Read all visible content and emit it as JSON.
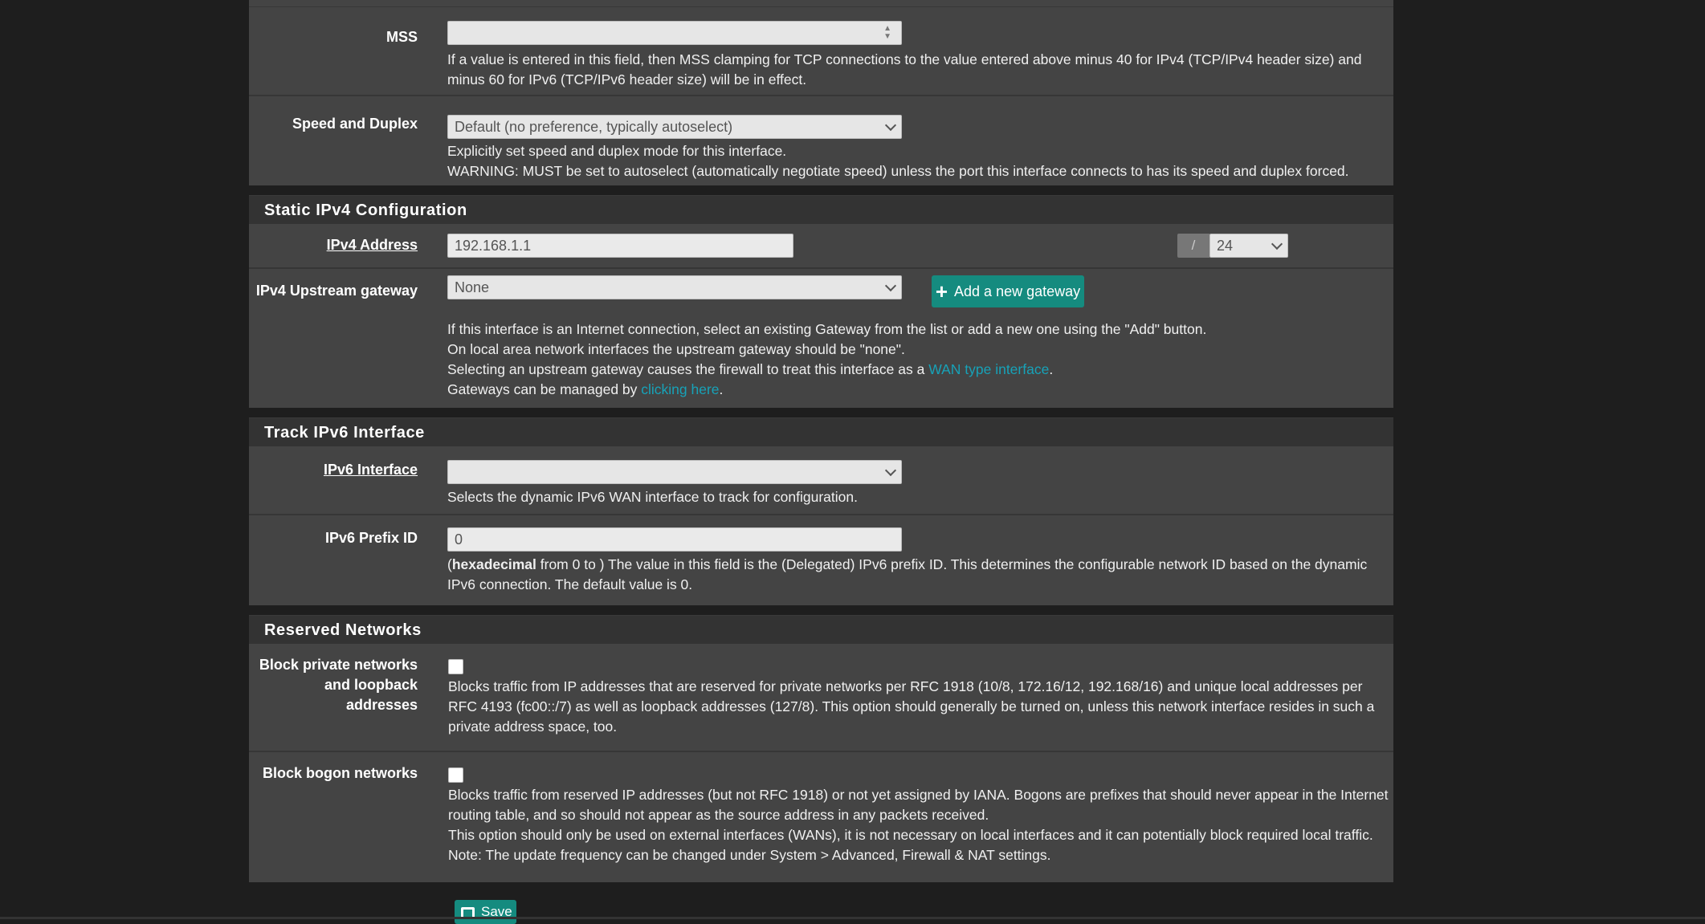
{
  "mss": {
    "label": "MSS",
    "value": "",
    "help": "If a value is entered in this field, then MSS clamping for TCP connections to the value entered above minus 40 for IPv4 (TCP/IPv4 header size) and minus 60 for IPv6 (TCP/IPv6 header size) will be in effect."
  },
  "speed": {
    "label": "Speed and Duplex",
    "selected": "Default (no preference, typically autoselect)",
    "help1": "Explicitly set speed and duplex mode for this interface.",
    "help2": "WARNING: MUST be set to autoselect (automatically negotiate speed) unless the port this interface connects to has its speed and duplex forced."
  },
  "static_ipv4": {
    "heading": "Static IPv4 Configuration",
    "address_label": "IPv4 Address",
    "address_value": "192.168.1.1",
    "slash": "/",
    "cidr": "24",
    "gateway_label": "IPv4 Upstream gateway",
    "gateway_selected": "None",
    "add_gateway_button": "Add a new gateway",
    "help1": "If this interface is an Internet connection, select an existing Gateway from the list or add a new one using the \"Add\" button.",
    "help2": "On local area network interfaces the upstream gateway should be \"none\".",
    "help3_pre": "Selecting an upstream gateway causes the firewall to treat this interface as a ",
    "help3_link": "WAN type interface",
    "help3_post": ".",
    "help4_pre": "Gateways can be managed by ",
    "help4_link": "clicking here",
    "help4_post": "."
  },
  "track_ipv6": {
    "heading": "Track IPv6 Interface",
    "interface_label": "IPv6 Interface",
    "interface_selected": "",
    "interface_help": "Selects the dynamic IPv6 WAN interface to track for configuration.",
    "prefix_label": "IPv6 Prefix ID",
    "prefix_value": "0",
    "prefix_help_bold": "hexadecimal",
    "prefix_help_open": "(",
    "prefix_help_rest": " from 0 to ) The value in this field is the (Delegated) IPv6 prefix ID. This determines the configurable network ID based on the dynamic IPv6 connection. The default value is 0."
  },
  "reserved": {
    "heading": "Reserved Networks",
    "private_label_1": "Block private networks",
    "private_label_2": "and loopback addresses",
    "private_help": "Blocks traffic from IP addresses that are reserved for private networks per RFC 1918 (10/8, 172.16/12, 192.168/16) and unique local addresses per RFC 4193 (fc00::/7) as well as loopback addresses (127/8). This option should generally be turned on, unless this network interface resides in such a private address space, too.",
    "bogon_label": "Block bogon networks",
    "bogon_help1": "Blocks traffic from reserved IP addresses (but not RFC 1918) or not yet assigned by IANA. Bogons are prefixes that should never appear in the Internet routing table, and so should not appear as the source address in any packets received.",
    "bogon_help2": "This option should only be used on external interfaces (WANs), it is not necessary on local interfaces and it can potentially block required local traffic.",
    "bogon_help3": "Note: The update frequency can be changed under System > Advanced, Firewall & NAT settings."
  },
  "save_button": "Save",
  "colors": {
    "accent": "#158b7f",
    "link": "#17a2b8",
    "panel": "#444444",
    "header": "#333333"
  }
}
